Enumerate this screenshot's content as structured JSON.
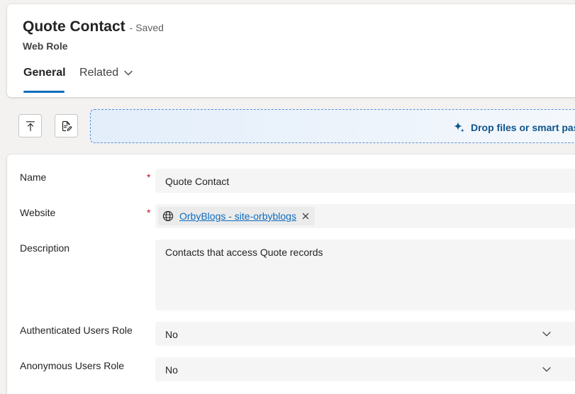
{
  "header": {
    "title": "Quote Contact",
    "status": "- Saved",
    "entity": "Web Role"
  },
  "tabs": [
    {
      "label": "General",
      "selected": true
    },
    {
      "label": "Related",
      "selected": false
    }
  ],
  "commands": {
    "top_icon": "arrow-up-to-top-icon",
    "note_icon": "document-edit-icon"
  },
  "drop_zone": {
    "text": "Drop files or smart pas",
    "icon": "sparkle-icon"
  },
  "form": {
    "name": {
      "label": "Name",
      "required": "*",
      "value": "Quote Contact"
    },
    "website": {
      "label": "Website",
      "required": "*",
      "value": "OrbyBlogs - site-orbyblogs",
      "icon": "globe-icon"
    },
    "description": {
      "label": "Description",
      "value": "Contacts that access Quote records"
    },
    "authenticated_users_role": {
      "label": "Authenticated Users Role",
      "value": "No"
    },
    "anonymous_users_role": {
      "label": "Anonymous Users Role",
      "value": "No"
    }
  },
  "colors": {
    "accent": "#0f6cbd",
    "required": "#c50f1f",
    "link": "#0f6cbd"
  }
}
